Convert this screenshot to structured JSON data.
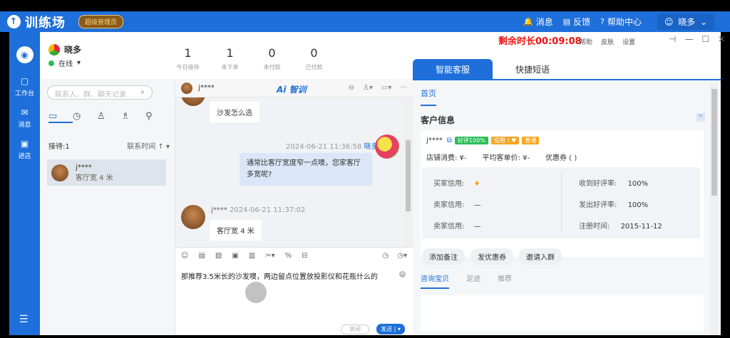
{
  "app": {
    "logo_text": "训练场",
    "admin_badge": "超级管理员",
    "nav": [
      {
        "icon": "bell-icon",
        "glyph": "🔔",
        "label": "消息"
      },
      {
        "icon": "feedback-icon",
        "glyph": "▤",
        "label": "反馈"
      },
      {
        "icon": "help-icon",
        "glyph": "?",
        "label": "帮助中心"
      }
    ],
    "user": "晓多"
  },
  "leftnav": {
    "items": [
      {
        "label": "工作台",
        "glyph": "▢"
      },
      {
        "label": "消息",
        "glyph": "✉"
      },
      {
        "label": "进店",
        "glyph": "▣"
      }
    ],
    "menu_glyph": "☰"
  },
  "profile": {
    "name": "晓多",
    "status": "在线"
  },
  "stats": [
    {
      "n": "1",
      "l": "今日接待"
    },
    {
      "n": "1",
      "l": "未下单"
    },
    {
      "n": "0",
      "l": "未付款"
    },
    {
      "n": "0",
      "l": "已付款"
    }
  ],
  "timer": "剩余时长00:09:08",
  "window": {
    "links": [
      "帮助",
      "皮肤",
      "设置"
    ],
    "controls": [
      "⊣",
      "—",
      "☐",
      "✕"
    ]
  },
  "contacts": {
    "search_placeholder": "联系人、群、聊天记录",
    "wait": "接待:1",
    "sort": "联系时间 ↑ ▾",
    "list": [
      {
        "name": "j****",
        "msg": "客厅宽 4 米"
      }
    ]
  },
  "chat": {
    "header_name": "j****",
    "ai_label": "Ai 智训",
    "messages": [
      {
        "text": "沙发怎么选"
      },
      {
        "time": "2024-06-21 11:36:58",
        "name": "晓多",
        "text": "通常比客厅宽度窄一点噢，您家客厅多宽呢?"
      },
      {
        "name": "j****",
        "time": "2024-06-21 11:37:02",
        "text": "客厅宽 4 米"
      }
    ],
    "input_text": "那推荐3.5米长的沙发噢，两边留点位置放投影仪和花瓶什么的",
    "close_label": "关闭",
    "send_label": "发送 | ▾"
  },
  "right": {
    "tabs": [
      "智能客服",
      "快捷短语"
    ],
    "home": "首页",
    "section": "客户信息",
    "customer": {
      "name": "j****",
      "tags": [
        {
          "t": "好评100%",
          "c": "#2cbd57"
        },
        {
          "t": "信用 ! ♥",
          "c": "#f5a623"
        },
        {
          "t": "普通",
          "c": "#f5a623"
        }
      ],
      "store_consume": "店铺消费: ¥-",
      "avg_price": "平均客单价: ¥-",
      "coupon": "优惠券 ( )",
      "credit": [
        {
          "k": "买家信用:",
          "v": "♦"
        },
        {
          "k": "卖家信用:",
          "v": "—"
        },
        {
          "k": "卖家信用:",
          "v": "—"
        }
      ],
      "rates": [
        {
          "k": "收到好评率:",
          "v": "100%"
        },
        {
          "k": "发出好评率:",
          "v": "100%"
        },
        {
          "k": "注册时间:",
          "v": "2015-11-12"
        }
      ]
    },
    "actions": [
      "添加备注",
      "发优惠券",
      "邀请入群"
    ],
    "subtabs": [
      "咨询宝贝",
      "足迹",
      "推荐"
    ]
  }
}
